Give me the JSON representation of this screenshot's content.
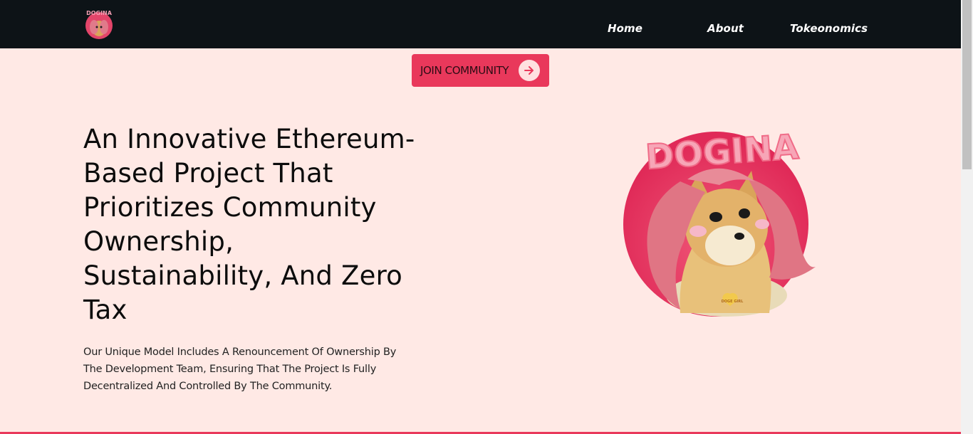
{
  "header": {
    "nav": [
      {
        "label": "Home"
      },
      {
        "label": "About"
      },
      {
        "label": "Tokeonomics"
      }
    ],
    "logo_text": "DOGINA"
  },
  "hero": {
    "cta_label": "JOIN COMMUNITY",
    "title": "An Innovative Ethereum-Based Project That Prioritizes Community Ownership, Sustainability, And Zero Tax",
    "description": "Our Unique Model Includes A Renouncement Of Ownership By The Development Team, Ensuring That The Project Is Fully Decentralized And Controlled By The Community.",
    "art_text": "DOGINA",
    "tag_text": "DOGE GIRL"
  },
  "colors": {
    "nav_bg": "#0d1317",
    "page_bg": "#ffe9e5",
    "accent": "#e9385b"
  }
}
